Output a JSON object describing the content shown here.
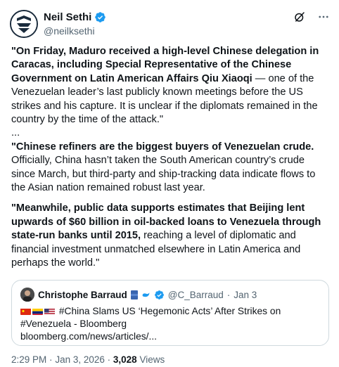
{
  "author": {
    "name": "Neil Sethi",
    "handle": "@neilksethi"
  },
  "icons": {
    "verified": "verified-badge-icon",
    "grok": "grok-icon",
    "more": "more-icon",
    "flags": [
      "china-flag",
      "venezuela-flag",
      "usa-flag"
    ]
  },
  "colors": {
    "verified_blue": "#1d9bf0",
    "secondary_text": "#536471",
    "border": "#cfd9de"
  },
  "body": {
    "p1_bold": "\"On Friday, Maduro received a high-level Chinese delegation in Caracas, including Special Representative of the Chinese Government on Latin American Affairs Qiu Xiaoqi",
    "p1_rest": " — one of the Venezuelan leader’s last publicly known meetings before the US strikes and his capture. It is unclear if the diplomats remained in the country by the time of the attack.\"",
    "ellipsis": "...",
    "p2_bold": "\"Chinese refiners are the biggest buyers of Venezuelan crude.",
    "p2_rest": " Officially, China hasn’t taken the South American country’s crude since March, but third-party and ship-tracking data indicate flows to the Asian nation remained robust last year.",
    "p3_bold": "\"Meanwhile, public data supports estimates that Beijing lent upwards of $60 billion in oil-backed loans to Venezuela through state-run banks until 2015,",
    "p3_rest": " reaching a level of diplomatic and financial investment unmatched elsewhere in Latin America and perhaps the world.\""
  },
  "quote": {
    "name": "Christophe Barraud",
    "handle": "@C_Barraud",
    "separator": "·",
    "date": "Jan 3",
    "text": "#China Slams US ‘Hegemonic Acts’ After Strikes on #Venezuela - Bloomberg",
    "link": "bloomberg.com/news/articles/..."
  },
  "footer": {
    "time": "2:29 PM",
    "separator": "·",
    "date": "Jan 3, 2026",
    "views_count": "3,028",
    "views_label": "Views"
  }
}
